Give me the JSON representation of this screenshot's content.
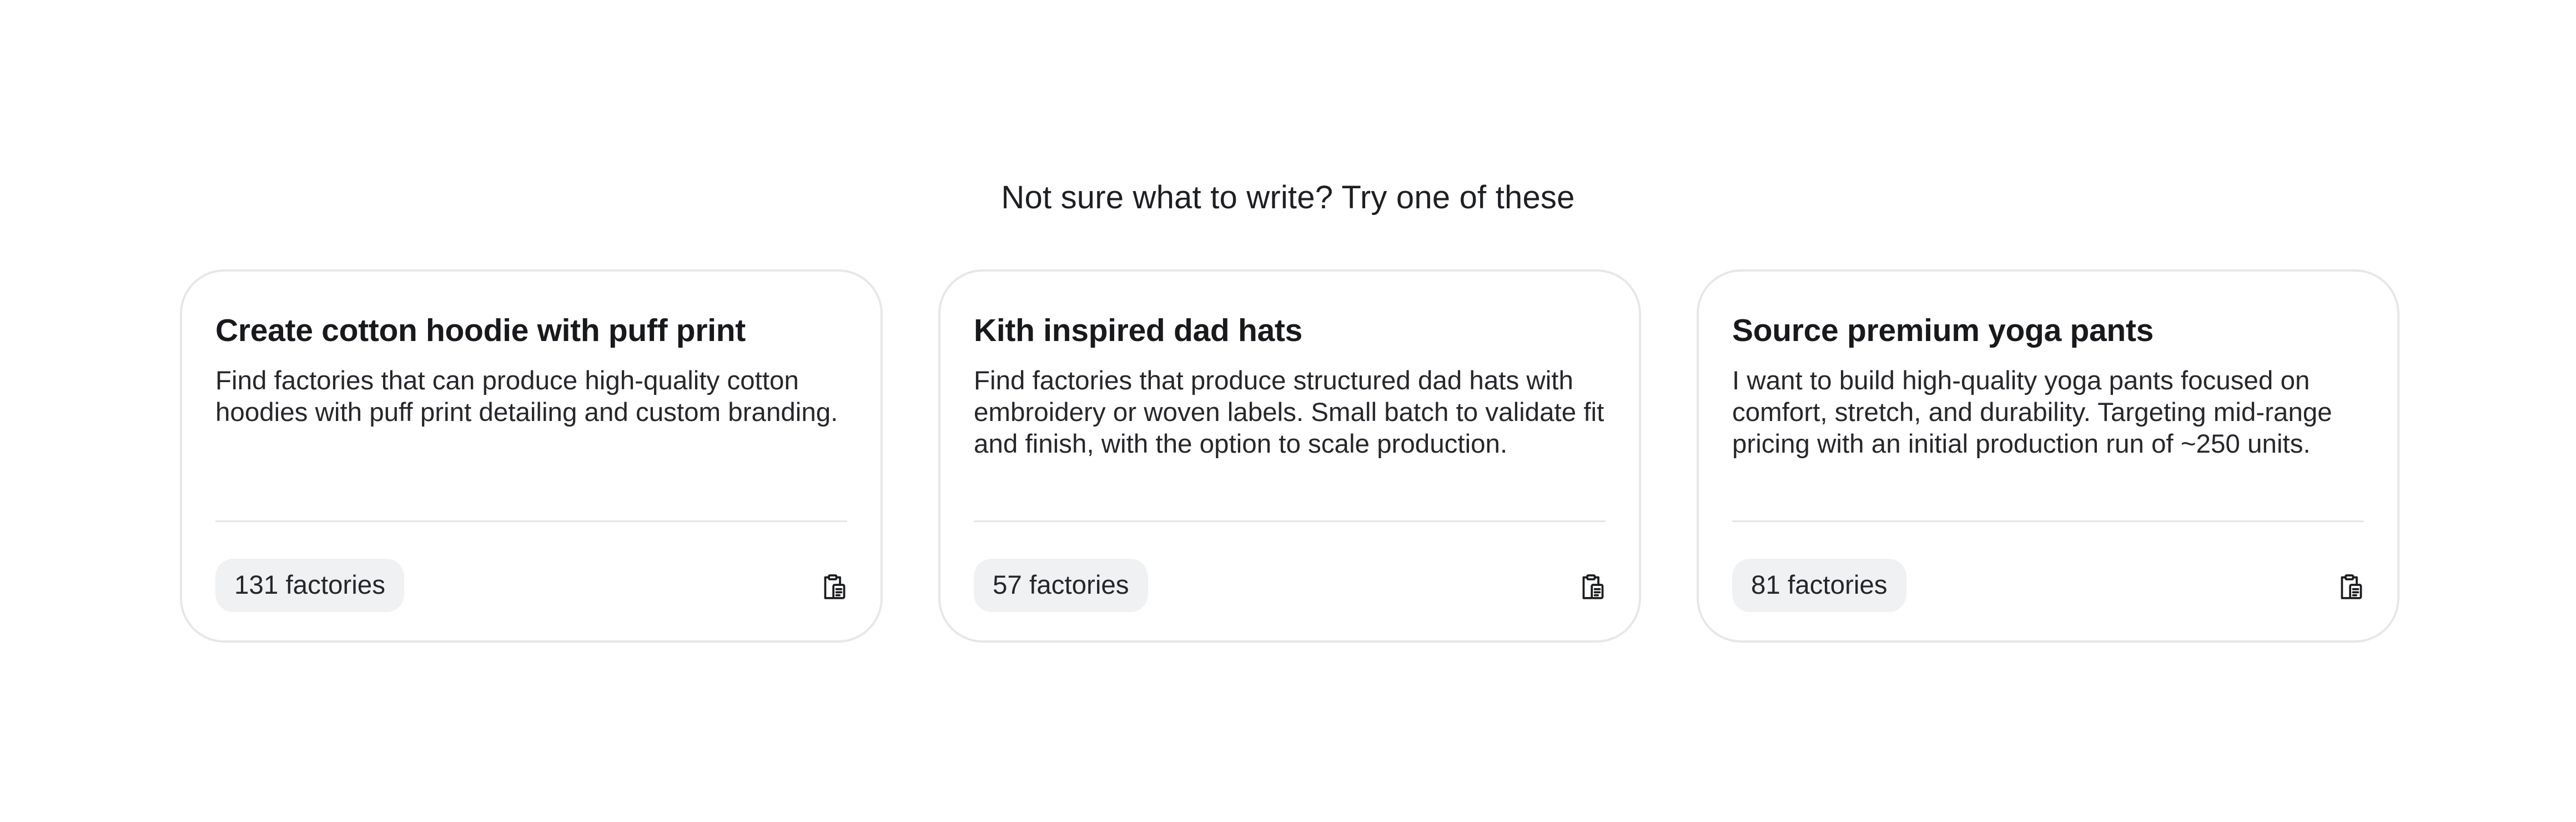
{
  "heading": "Not sure what to write? Try one of these",
  "cards": [
    {
      "title": "Create cotton hoodie with puff print",
      "description": "Find factories that can produce high-quality cotton hoodies with puff print detailing and custom branding.",
      "factories": "131 factories",
      "action_icon": "copy-to-clipboard-icon"
    },
    {
      "title": "Kith inspired dad hats",
      "description": "Find factories that produce structured dad hats with embroidery or woven labels. Small batch to validate fit and finish, with the option to scale production.",
      "factories": "57 factories",
      "action_icon": "copy-to-clipboard-icon"
    },
    {
      "title": "Source premium yoga pants",
      "description": "I want to build high-quality yoga pants focused on comfort, stretch, and durability. Targeting mid-range pricing with an initial production run of ~250 units.",
      "factories": "81 factories",
      "action_icon": "copy-to-clipboard-icon"
    }
  ],
  "colors": {
    "card_border": "#e7e7ea",
    "badge_background": "#f0f1f3",
    "text": "#1b1c1f"
  }
}
